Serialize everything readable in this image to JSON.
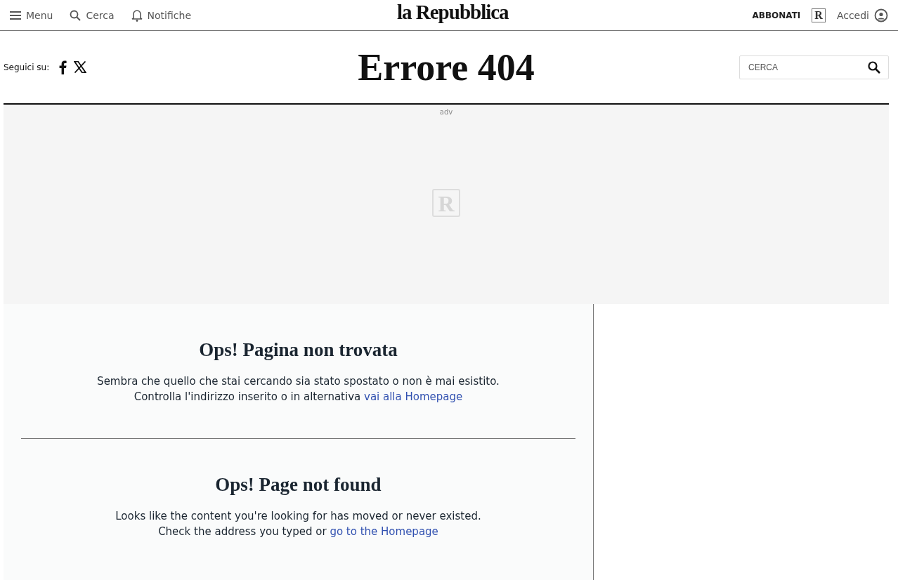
{
  "header": {
    "menu": "Menu",
    "search": "Cerca",
    "notifications": "Notifiche",
    "logo": "la Repubblica",
    "subscribe": "ABBONATI",
    "badge": "R",
    "login": "Accedi"
  },
  "follow": {
    "label": "Seguici su:"
  },
  "title": "Errore 404",
  "search": {
    "placeholder": "CERCA"
  },
  "ad": {
    "label": "adv",
    "logo": "R"
  },
  "messages": [
    {
      "heading": "Ops! Pagina non trovata",
      "line1": "Sembra che quello che stai cercando sia stato spostato o non è mai esistito.",
      "line2": "Controlla l'indirizzo inserito o in alternativa",
      "link": "vai alla Homepage"
    },
    {
      "heading": "Ops! Page not found",
      "line1": "Looks like the content you're looking for has moved or never existed.",
      "line2": "Check the address you typed or",
      "link": "go to the Homepage"
    }
  ]
}
